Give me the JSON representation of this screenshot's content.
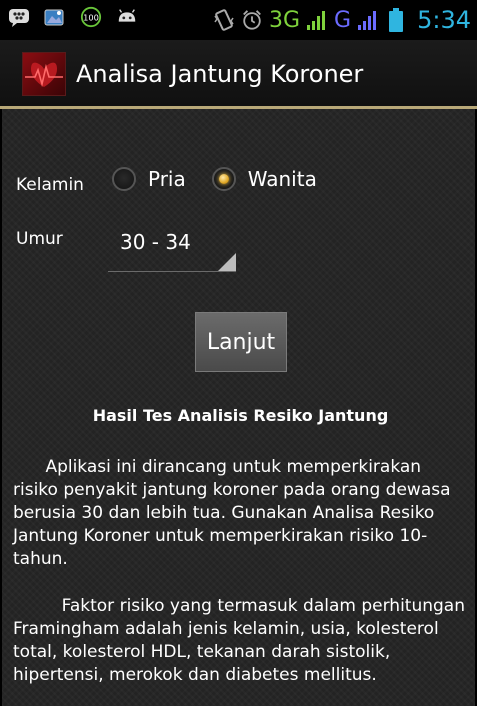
{
  "status_bar": {
    "left_icons": [
      "bbm-icon",
      "image-icon",
      "battery-100-badge-icon",
      "android-icon"
    ],
    "battery_badge": "100",
    "network_3g": "3G",
    "network_g": "G",
    "time": "5:34",
    "accent_color": "#2fb5e0",
    "signal_color": "#7fd23c"
  },
  "app": {
    "title": "Analisa Jantung Koroner",
    "icon": "heart-ecg-app-icon"
  },
  "form": {
    "gender_label": "Kelamin",
    "gender_options": [
      "Pria",
      "Wanita"
    ],
    "gender_selected": "Wanita",
    "age_label": "Umur",
    "age_value": "30 - 34",
    "next_button": "Lanjut"
  },
  "info": {
    "heading": "Hasil Tes Analisis Resiko Jantung",
    "paragraph1": "      Aplikasi ini dirancang untuk memperkirakan risiko penyakit jantung koroner pada orang dewasa berusia 30 dan lebih tua. Gunakan Analisa Resiko Jantung Koroner untuk memperkirakan risiko 10-tahun.",
    "paragraph2": "         Faktor risiko yang termasuk dalam perhitungan Framingham adalah jenis kelamin, usia, kolesterol total, kolesterol HDL, tekanan darah sistolik, hipertensi, merokok dan diabetes mellitus."
  }
}
